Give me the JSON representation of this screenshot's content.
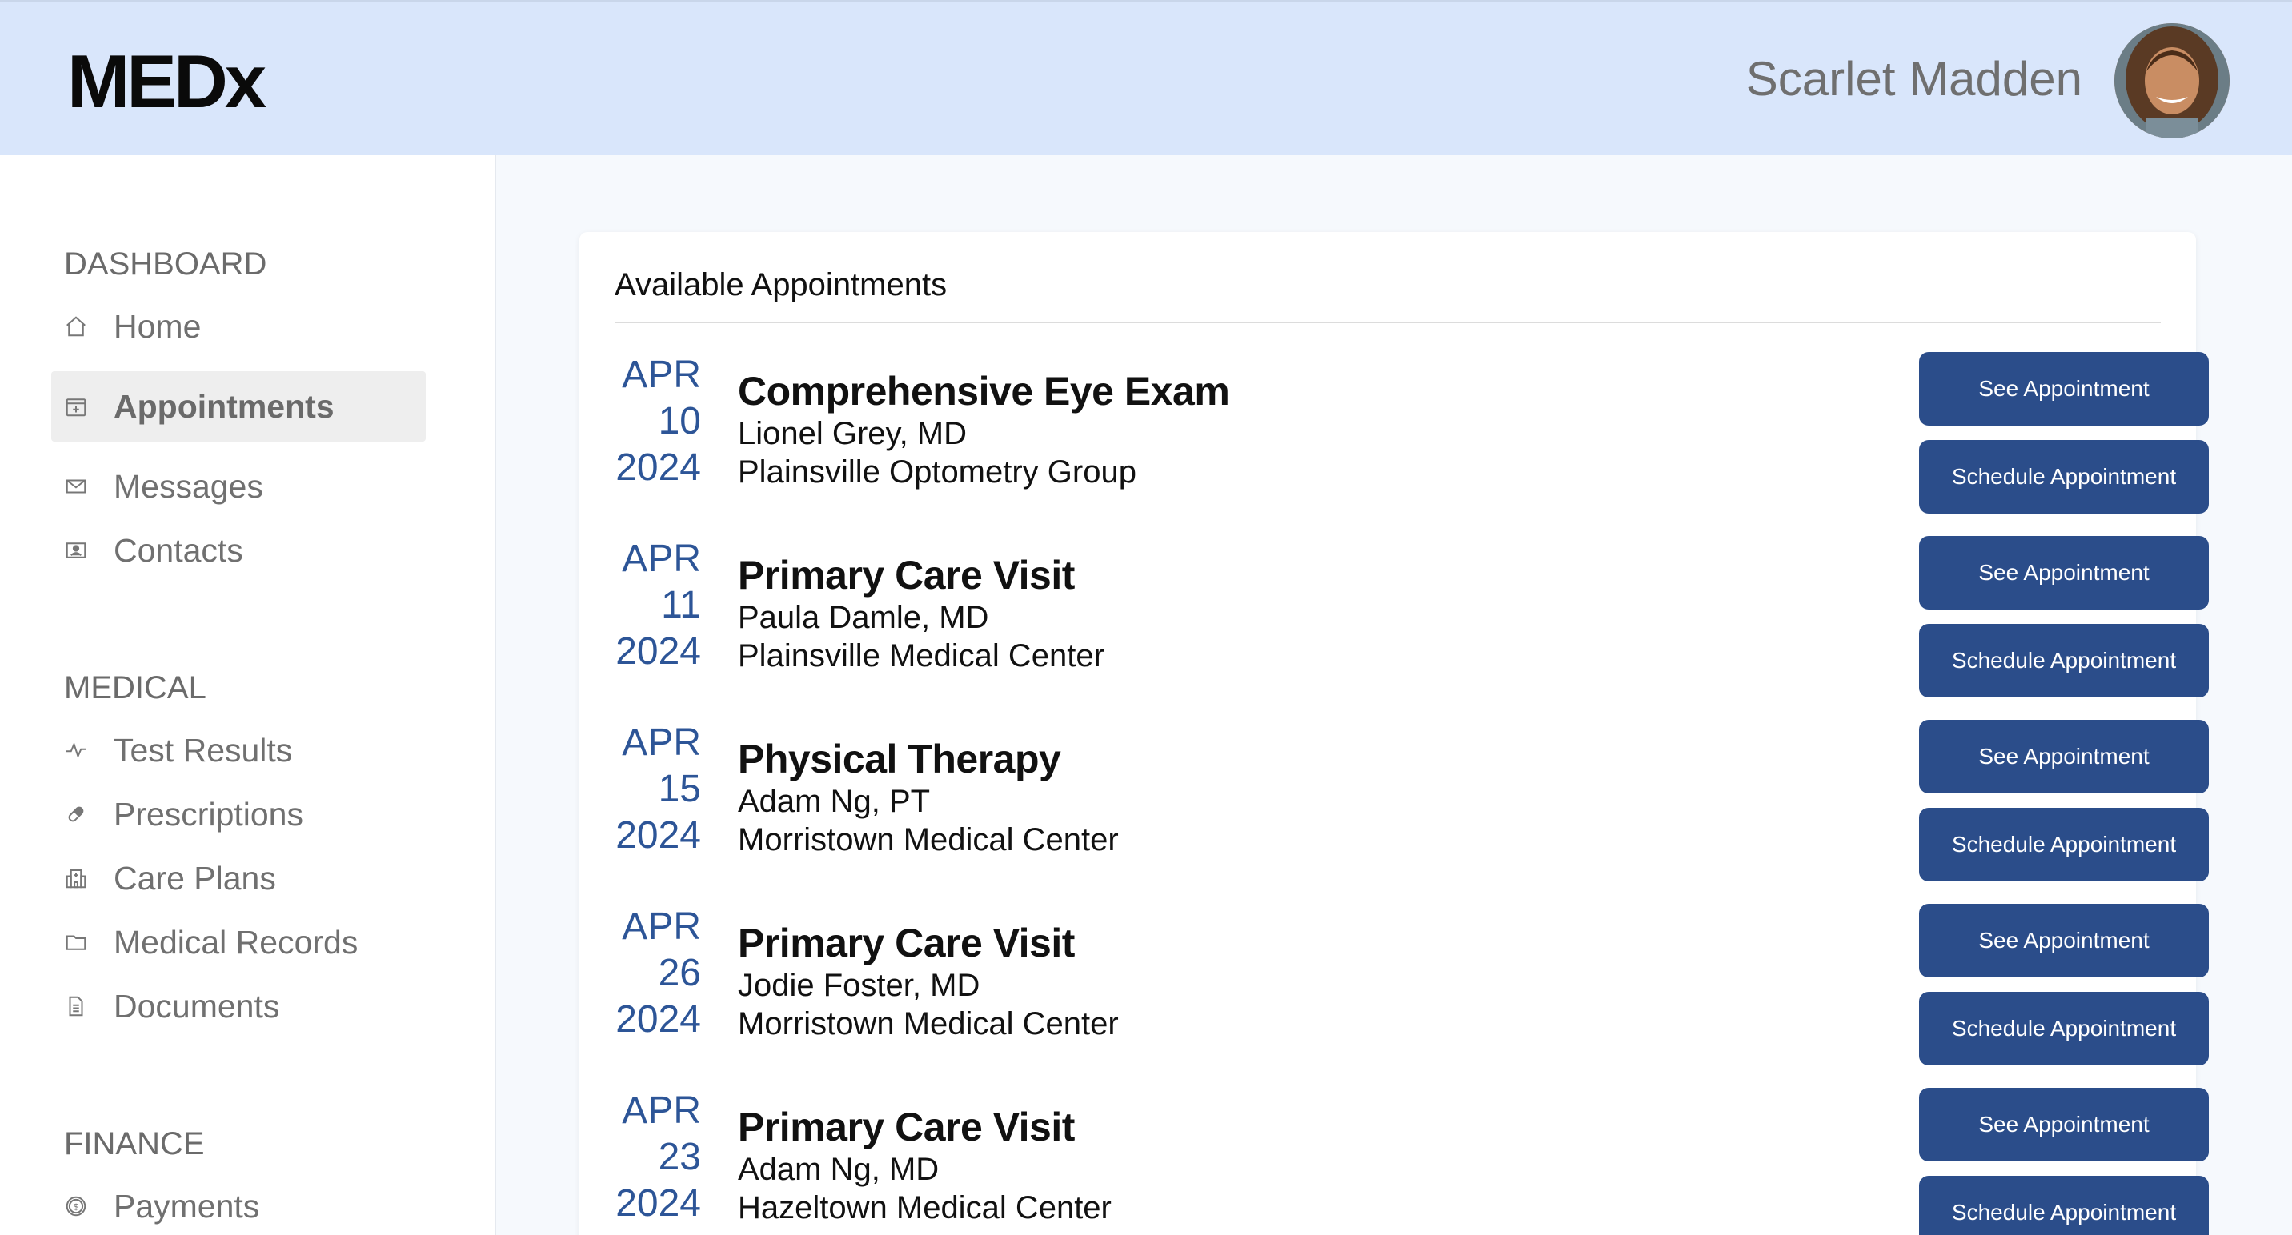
{
  "header": {
    "logo": "MEDx",
    "user_name": "Scarlet Madden"
  },
  "sidebar": {
    "sections": [
      {
        "title": "DASHBOARD",
        "items": [
          {
            "label": "Home",
            "icon": "home-icon"
          },
          {
            "label": "Appointments",
            "icon": "calendar-icon",
            "active": true
          },
          {
            "label": "Messages",
            "icon": "envelope-icon"
          },
          {
            "label": "Contacts",
            "icon": "contact-card-icon"
          }
        ]
      },
      {
        "title": "MEDICAL",
        "items": [
          {
            "label": "Test Results",
            "icon": "pulse-icon"
          },
          {
            "label": "Prescriptions",
            "icon": "pill-icon"
          },
          {
            "label": "Care Plans",
            "icon": "hospital-icon"
          },
          {
            "label": "Medical Records",
            "icon": "folder-icon"
          },
          {
            "label": "Documents",
            "icon": "document-icon"
          }
        ]
      },
      {
        "title": "FINANCE",
        "items": [
          {
            "label": "Payments",
            "icon": "dollar-coin-icon"
          }
        ]
      }
    ]
  },
  "main": {
    "title": "Available Appointments",
    "see_label": "See Appointment",
    "schedule_label": "Schedule Appointment",
    "appointments": [
      {
        "month": "APR",
        "day": "10",
        "year": "2024",
        "title": "Comprehensive Eye Exam",
        "doctor": "Lionel Grey, MD",
        "location": "Plainsville Optometry Group"
      },
      {
        "month": "APR",
        "day": "11",
        "year": "2024",
        "title": "Primary Care Visit",
        "doctor": "Paula Damle, MD",
        "location": "Plainsville Medical Center"
      },
      {
        "month": "APR",
        "day": "15",
        "year": "2024",
        "title": "Physical Therapy",
        "doctor": "Adam Ng, PT",
        "location": "Morristown Medical Center"
      },
      {
        "month": "APR",
        "day": "26",
        "year": "2024",
        "title": "Primary Care Visit",
        "doctor": "Jodie Foster, MD",
        "location": "Morristown Medical Center"
      },
      {
        "month": "APR",
        "day": "23",
        "year": "2024",
        "title": "Primary Care Visit",
        "doctor": "Adam Ng, MD",
        "location": "Hazeltown Medical Center"
      }
    ]
  },
  "colors": {
    "header_bg": "#d9e6fb",
    "accent": "#2b4d8a",
    "date_text": "#2d5597"
  }
}
